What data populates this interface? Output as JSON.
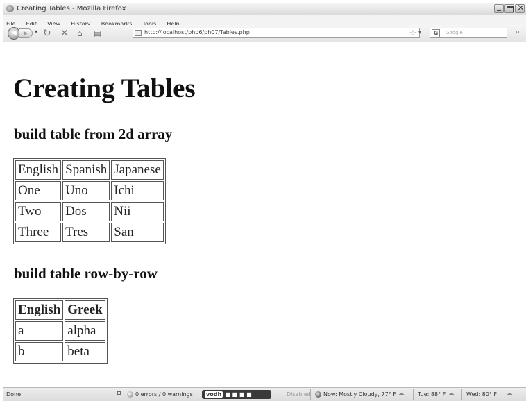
{
  "window": {
    "title": "Creating Tables - Mozilla Firefox"
  },
  "menu": [
    "File",
    "Edit",
    "View",
    "History",
    "Bookmarks",
    "Tools",
    "Help"
  ],
  "nav": {
    "url": "http://localhost/php6/ph07/Tables.php",
    "search_placeholder": "Google"
  },
  "page": {
    "heading": "Creating Tables",
    "section1_heading": "build table from 2d array",
    "table1": [
      [
        "English",
        "Spanish",
        "Japanese"
      ],
      [
        "One",
        "Uno",
        "Ichi"
      ],
      [
        "Two",
        "Dos",
        "Nii"
      ],
      [
        "Three",
        "Tres",
        "San"
      ]
    ],
    "section2_heading": "build table row-by-row",
    "table2": {
      "headers": [
        "English",
        "Greek"
      ],
      "rows": [
        [
          "a",
          "alpha"
        ],
        [
          "b",
          "beta"
        ]
      ]
    }
  },
  "status": {
    "text": "Done",
    "errors": "0 errors / 0 warnings",
    "vodh": "vodh",
    "disabled": "Disabled",
    "weather_now": "Now: Mostly Cloudy, 77° F",
    "weather_tue": "Tue: 88° F",
    "weather_wed": "Wed: 80° F"
  }
}
